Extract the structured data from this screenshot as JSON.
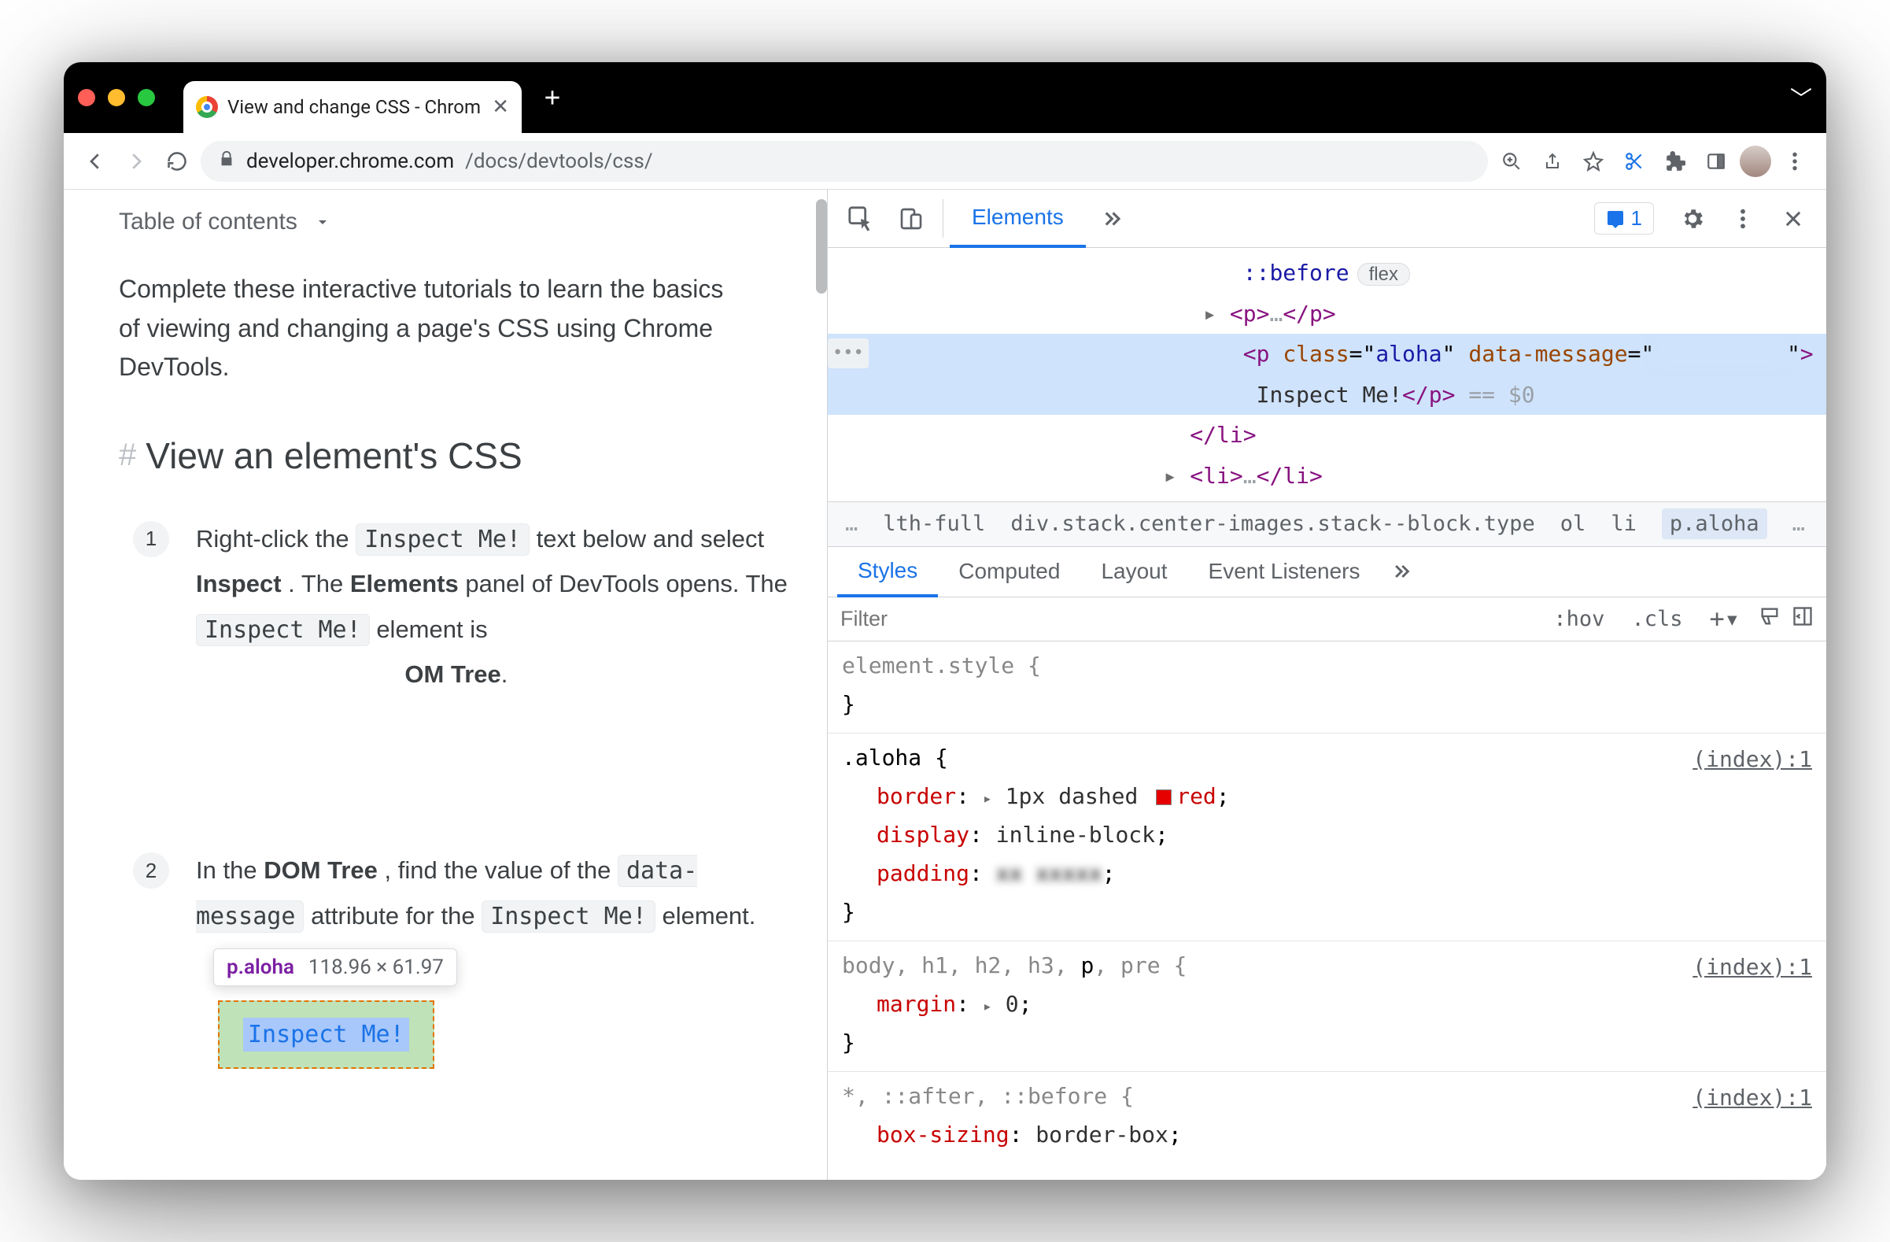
{
  "titlebar": {
    "tab_title": "View and change CSS - Chrom"
  },
  "addressbar": {
    "domain": "developer.chrome.com",
    "path": "/docs/devtools/css/"
  },
  "page": {
    "toc_label": "Table of contents",
    "intro": "Complete these interactive tutorials to learn the basics of viewing and changing a page's CSS using Chrome DevTools.",
    "heading": "View an element's CSS",
    "step1": {
      "pre": "Right-click the ",
      "chip1": "Inspect Me!",
      "mid1": " text below and select ",
      "b1": "Inspect",
      "mid2": ". The ",
      "b2": "Elements",
      "mid3": " panel of DevTools opens. The ",
      "chip2": "Inspect Me!",
      "mid4": " element is",
      "b3": "OM Tree",
      "tail": "."
    },
    "step2": {
      "pre": "In the ",
      "b1": "DOM Tree",
      "mid1": ", find the value of the ",
      "chip1": "data-message",
      "mid2": " attribute for the ",
      "chip2": "Inspect Me!",
      "tail": " element."
    },
    "tooltip_selector": "p.aloha",
    "tooltip_dims": "118.96 × 61.97",
    "inspect_text": "Inspect Me!"
  },
  "devtools": {
    "tab_elements": "Elements",
    "issues_count": "1",
    "dom": {
      "before": "::before",
      "flex": "flex",
      "p_open": "<p>",
      "p_close": "</p>",
      "ellipsis": "…",
      "sel_open": "<p class=\"aloha\" data-message=\"",
      "sel_close": "\">",
      "text": "Inspect Me!",
      "close_p": "</p>",
      "eq0": " == $0",
      "li_close": "</li>",
      "li_open": "<li>",
      "li_close2": "</li>"
    },
    "crumb": {
      "c1": "lth-full",
      "c2": "div.stack.center-images.stack--block.type",
      "c3": "ol",
      "c4": "li",
      "c5": "p.aloha"
    },
    "subtabs": {
      "styles": "Styles",
      "computed": "Computed",
      "layout": "Layout",
      "events": "Event Listeners"
    },
    "filter_placeholder": "Filter",
    "tools": {
      "hov": ":hov",
      "cls": ".cls"
    },
    "rules": {
      "r0_sel": "element.style {",
      "r1_sel": ".aloha {",
      "r1_src": "(index):1",
      "r1_p1n": "border",
      "r1_p1v": "1px dashed",
      "r1_p1c": "red",
      "r1_p2n": "display",
      "r1_p2v": "inline-block",
      "r1_p3n": "padding",
      "r2_sel": "body, h1, h2, h3, p, pre {",
      "r2_src": "(index):1",
      "r2_p1n": "margin",
      "r2_p1v": "0",
      "r3_sel": "*, ::after, ::before {",
      "r3_src": "(index):1",
      "r3_p1n": "box-sizing",
      "r3_p1v": "border-box"
    }
  }
}
